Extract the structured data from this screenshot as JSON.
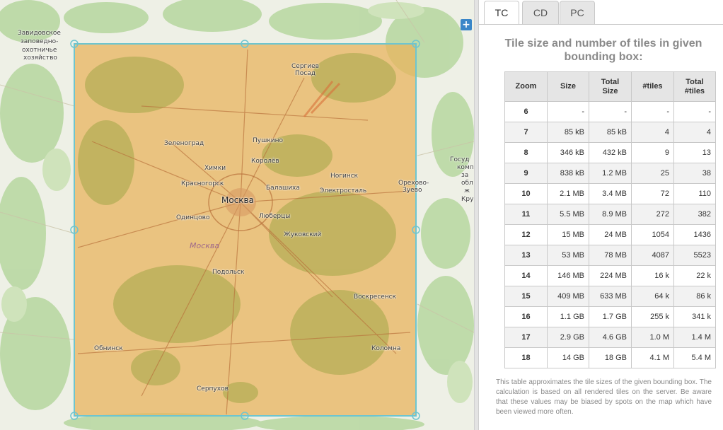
{
  "map": {
    "zoom_in_label": "+",
    "cities": {
      "zavidovskoe": "Завидовское",
      "zapovedno": "заповедно-",
      "okhotniche": "охотничье",
      "khozyaystvo": "хозяйство",
      "sergiev": "Сергиев",
      "posad": "Посад",
      "pushkino": "Пушкино",
      "zelenograd": "Зеленоград",
      "korolev": "Королёв",
      "khimki": "Химки",
      "noginsk": "Ногинск",
      "krasnogorsk": "Красногорск",
      "balashikha": "Балашиха",
      "elektrostal": "Электросталь",
      "orekhovo": "Орехово-",
      "zuevo": "Зуево",
      "moskva": "Москва",
      "odintsovo": "Одинцово",
      "lyubertsy": "Люберцы",
      "zhukovsky": "Жуковский",
      "moskva_region": "Москва",
      "podolsk": "Подольск",
      "voskresensk": "Воскресенск",
      "obninsk": "Обнинск",
      "kolomna": "Коломна",
      "serpukhov": "Серпухов",
      "gosud": "Госуд",
      "komp": "комп",
      "za": "за",
      "obl": "обл",
      "zh": "ж",
      "kru": "Кру"
    }
  },
  "tabs": [
    "TC",
    "CD",
    "PC"
  ],
  "title": "Tile size and number of tiles in given bounding box:",
  "table": {
    "headers": [
      "Zoom",
      "Size",
      "Total Size",
      "#tiles",
      "Total #tiles"
    ],
    "rows": [
      [
        "6",
        "-",
        "-",
        "-",
        "-"
      ],
      [
        "7",
        "85 kB",
        "85 kB",
        "4",
        "4"
      ],
      [
        "8",
        "346 kB",
        "432 kB",
        "9",
        "13"
      ],
      [
        "9",
        "838 kB",
        "1.2 MB",
        "25",
        "38"
      ],
      [
        "10",
        "2.1 MB",
        "3.4 MB",
        "72",
        "110"
      ],
      [
        "11",
        "5.5 MB",
        "8.9 MB",
        "272",
        "382"
      ],
      [
        "12",
        "15 MB",
        "24 MB",
        "1054",
        "1436"
      ],
      [
        "13",
        "53 MB",
        "78 MB",
        "4087",
        "5523"
      ],
      [
        "14",
        "146 MB",
        "224 MB",
        "16 k",
        "22 k"
      ],
      [
        "15",
        "409 MB",
        "633 MB",
        "64 k",
        "86 k"
      ],
      [
        "16",
        "1.1 GB",
        "1.7 GB",
        "255 k",
        "341 k"
      ],
      [
        "17",
        "2.9 GB",
        "4.6 GB",
        "1.0 M",
        "1.4 M"
      ],
      [
        "18",
        "14 GB",
        "18 GB",
        "4.1 M",
        "5.4 M"
      ]
    ]
  },
  "note": "This table approximates the tile sizes of the given bounding box. The calculation is based on all rendered tiles on the server. Be aware that these values may be biased by spots on the map which have been viewed more often."
}
